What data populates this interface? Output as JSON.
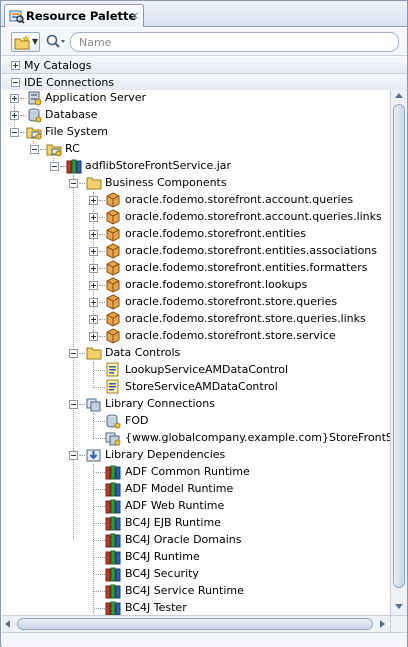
{
  "panel": {
    "title": "Resource Palette",
    "close_glyph": "×",
    "icon": "resource-palette-icon"
  },
  "toolbar": {
    "new_button_icon": "new-folder-icon",
    "search_type_icon": "search-icon",
    "search_placeholder": "Name",
    "search_value": ""
  },
  "sections": {
    "my_catalogs": {
      "label": "My Catalogs",
      "expanded": false
    },
    "ide_connections": {
      "label": "IDE Connections",
      "expanded": true
    }
  },
  "tree": {
    "application_server": "Application Server",
    "database": "Database",
    "file_system": "File System",
    "rc": "RC",
    "jar": "adflibStoreFrontService.jar",
    "business_components": {
      "label": "Business Components",
      "items": [
        "oracle.fodemo.storefront.account.queries",
        "oracle.fodemo.storefront.account.queries.links",
        "oracle.fodemo.storefront.entities",
        "oracle.fodemo.storefront.entities.associations",
        "oracle.fodemo.storefront.entities.formatters",
        "oracle.fodemo.storefront.lookups",
        "oracle.fodemo.storefront.store.queries",
        "oracle.fodemo.storefront.store.queries.links",
        "oracle.fodemo.storefront.store.service"
      ]
    },
    "data_controls": {
      "label": "Data Controls",
      "items": [
        "LookupServiceAMDataControl",
        "StoreServiceAMDataControl"
      ]
    },
    "library_connections": {
      "label": "Library Connections",
      "items": [
        "FOD",
        "{www.globalcompany.example.com}StoreFrontService"
      ]
    },
    "library_dependencies": {
      "label": "Library Dependencies",
      "items": [
        "ADF Common Runtime",
        "ADF Model Runtime",
        "ADF Web Runtime",
        "BC4J EJB Runtime",
        "BC4J Oracle Domains",
        "BC4J Runtime",
        "BC4J Security",
        "BC4J Service Runtime",
        "BC4J Tester"
      ]
    }
  },
  "colors": {
    "frame_border": "#8a99ad",
    "folder_yellow": "#f2d36b",
    "package_orange": "#d9822b",
    "library_red": "#c0392b",
    "library_green": "#2e9a3e",
    "library_blue": "#2f5fb3"
  }
}
